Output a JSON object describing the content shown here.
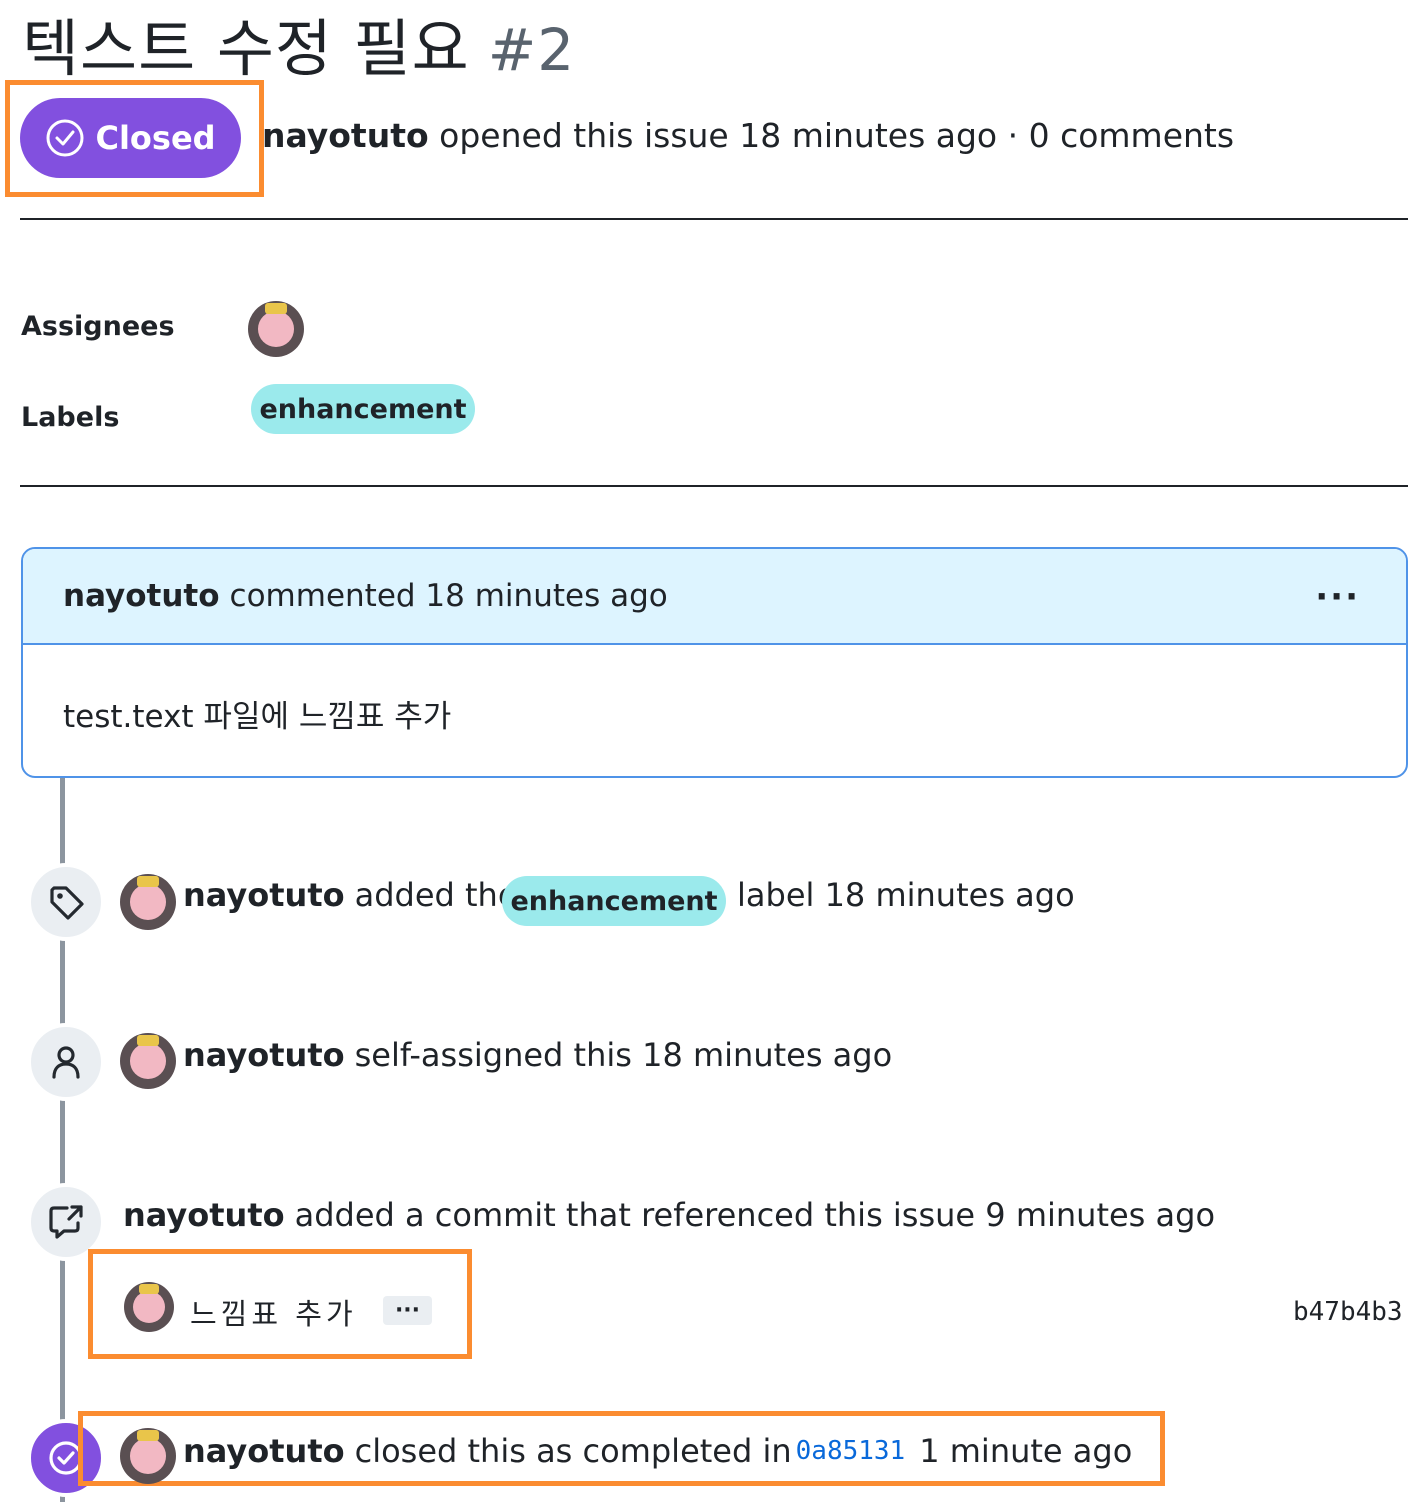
{
  "issue": {
    "title": "텍스트 수정 필요",
    "number": "#2",
    "state_label": "Closed",
    "author": "nayotuto",
    "opened_text": "opened this issue 18 minutes ago · 0 comments"
  },
  "sidebar": {
    "assignees_label": "Assignees",
    "labels_label": "Labels",
    "label_name": "enhancement"
  },
  "comment": {
    "author": "nayotuto",
    "meta": "commented 18 minutes ago",
    "more": "···",
    "body": "test.text 파일에 느낌표 추가"
  },
  "timeline": {
    "label_event": {
      "author": "nayotuto",
      "pre": "added the",
      "label": "enhancement",
      "post": "label 18 minutes ago"
    },
    "assign_event": {
      "author": "nayotuto",
      "text": "self-assigned this 18 minutes ago"
    },
    "commit_event": {
      "author": "nayotuto",
      "text": "added a commit that referenced this issue 9 minutes ago"
    },
    "commit": {
      "message": "느낌표 추가",
      "more": "···",
      "sha": "b47b4b3"
    },
    "close_event": {
      "author": "nayotuto",
      "pre": "closed this as completed in",
      "sha": "0a85131",
      "post": "1 minute ago"
    }
  },
  "colors": {
    "closed_purple": "#8250df",
    "highlight_orange": "#fb8c30",
    "label_bg": "#9beaec",
    "comment_border": "#4f93e8",
    "comment_header_bg": "#ddf4ff",
    "link_blue": "#0969da"
  },
  "icons": [
    "check-circle-icon",
    "tag-icon",
    "person-icon",
    "cross-reference-icon",
    "check-circle-icon"
  ]
}
